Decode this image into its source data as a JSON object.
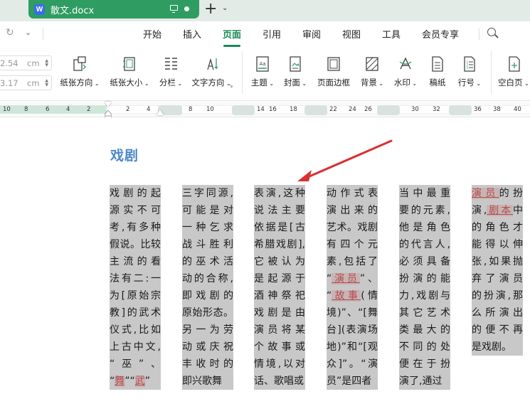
{
  "window": {
    "tab_title": "散文.docx",
    "logo_letter": "W"
  },
  "menu": {
    "items": [
      "开始",
      "插入",
      "页面",
      "引用",
      "审阅",
      "视图",
      "工具",
      "会员专享"
    ],
    "active": "页面"
  },
  "toolbar": {
    "margin_top_value": "2.54",
    "margin_bottom_value": "3.17",
    "margin_unit": "cm",
    "buttons": [
      {
        "label": "纸张方向",
        "icon": "page-orientation-icon",
        "dropdown": true
      },
      {
        "label": "纸张大小",
        "icon": "page-size-icon",
        "dropdown": true
      },
      {
        "label": "分栏",
        "icon": "columns-icon",
        "dropdown": true
      },
      {
        "label": "文字方向",
        "icon": "text-direction-icon",
        "dropdown": true
      },
      {
        "label": "主题",
        "icon": "theme-icon",
        "dropdown": true
      },
      {
        "label": "封面",
        "icon": "cover-icon",
        "dropdown": true
      },
      {
        "label": "页面边框",
        "icon": "page-border-icon",
        "dropdown": false
      },
      {
        "label": "背景",
        "icon": "background-icon",
        "dropdown": true
      },
      {
        "label": "水印",
        "icon": "watermark-icon",
        "dropdown": true
      },
      {
        "label": "稿纸",
        "icon": "manuscript-icon",
        "dropdown": false
      },
      {
        "label": "行号",
        "icon": "line-number-icon",
        "dropdown": true
      },
      {
        "label": "空白页",
        "icon": "blank-page-icon",
        "dropdown": true
      }
    ]
  },
  "ruler": {
    "labels": [
      "10",
      "8",
      "6",
      "4",
      "2",
      "2",
      "4",
      "8",
      "10",
      "14",
      "16",
      "18",
      "22",
      "24",
      "26",
      "30",
      "32",
      "36",
      "38",
      "40"
    ]
  },
  "document": {
    "heading": "戏剧",
    "columns": [
      [
        "戏剧的起",
        "源实不可",
        "考,有多种",
        "假说。比较",
        "主流的看",
        "法有二:一",
        "为[原始宗",
        "教]的武术",
        "仪式,比如",
        "上古中文,",
        "“巫”、",
        "“[舞]”“[武]”"
      ],
      [
        "三字同源,",
        "可能是对",
        "一种乞求",
        "战斗胜利",
        "的巫术活",
        "动的合称,",
        "即戏剧的",
        "原始形态。",
        "另一为劳",
        "动或庆祝",
        "丰收时的",
        "即兴歌舞"
      ],
      [
        "表演,这种",
        "说法主要",
        "依据是[古",
        "希腊戏剧],",
        "它被认为",
        "是起源于",
        "酒神祭祀",
        "戏剧是由",
        "演员将某",
        "个故事或",
        "情境,以对",
        "话、歌唱或"
      ],
      [
        "动作式表",
        "演出来的",
        "艺术。戏剧",
        "有四个元",
        "素,包括了",
        "“[演员]”、",
        "“[故事](情",
        "境)”、“[舞",
        "台](表演场",
        "地)”和“[观",
        "众]”。“演",
        "员”是四者"
      ],
      [
        "当中最重",
        "要的元素,",
        "他是角色",
        "的代言人,",
        "必须具备",
        "扮演的能",
        "力,戏剧与",
        "其它艺术",
        "类最大的",
        "不同的处",
        "便在于扮",
        "演了,通过"
      ],
      [
        "[演员]的扮",
        "演,[剧本]中",
        "的角色才",
        "能得以伸",
        "张,如果抛",
        "弃了演员",
        "的扮演,那",
        "么所演出",
        "的便不再",
        "是戏剧。"
      ]
    ]
  },
  "colors": {
    "accent": "#1c8a55",
    "tab_green": "#2f9c62",
    "heading_blue": "#4b88c6",
    "selection_gray": "#c8c8c8",
    "link_red": "#b34b4b",
    "arrow_red": "#d93030"
  }
}
